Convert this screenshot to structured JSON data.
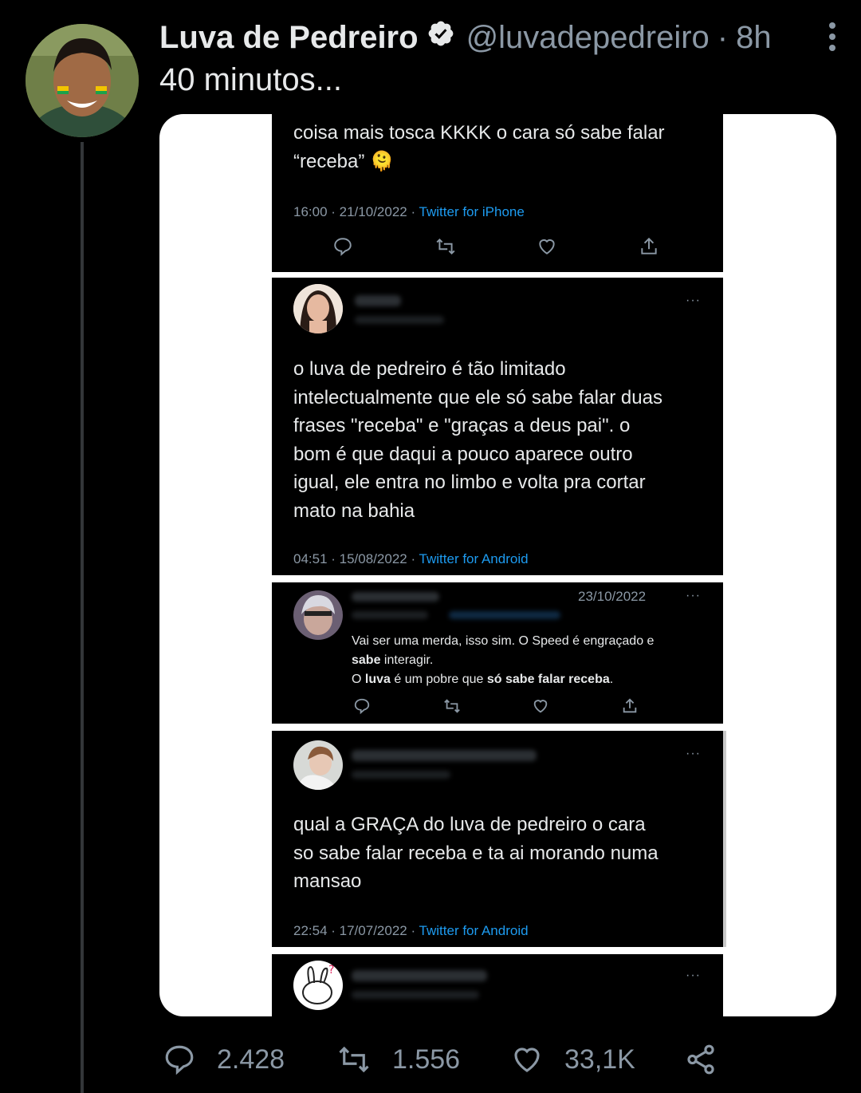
{
  "tweet": {
    "author_name": "Luva de Pedreiro",
    "handle": "@luvadepedreiro",
    "separator": "·",
    "time": "8h",
    "text": "40 minutos...",
    "verified_icon": "verified-badge-icon",
    "more_icon": "vertical-dots-icon"
  },
  "media": {
    "shot1": {
      "text": "coisa mais tosca KKKK o cara só sabe falar\n“receba” 🫠",
      "time": "16:00 · 21/10/2022 · ",
      "source": "Twitter for iPhone"
    },
    "shot2": {
      "text": "o luva de pedreiro é tão limitado\nintelectualmente que ele só sabe falar duas\nfrases \"receba\" e \"graças a deus pai\". o\nbom é que daqui a pouco aparece outro\nigual, ele entra no limbo e volta pra cortar\nmato na bahia",
      "time": "04:51 · 15/08/2022 · ",
      "source": "Twitter for Android",
      "more": "···"
    },
    "shot3": {
      "date": "23/10/2022",
      "line1": "Vai ser uma merda, isso sim. O Speed é engraçado e",
      "line2_bold": "sabe",
      "line2_rest": " interagir.",
      "line3_start": "O ",
      "line3_bold1": "luva",
      "line3_mid": " é um pobre que ",
      "line3_bold2": "só sabe falar receba",
      "line3_end": ".",
      "more": "···"
    },
    "shot4": {
      "text": "qual a GRAÇA do luva de pedreiro o cara\nso sabe falar receba e ta ai morando numa\nmansao",
      "time": "22:54 · 17/07/2022 · ",
      "source": "Twitter for Android",
      "more": "···"
    },
    "shot5": {
      "more": "···"
    }
  },
  "actions": {
    "replies": "2.428",
    "retweets": "1.556",
    "likes": "33,1K"
  },
  "colors": {
    "background": "#000000",
    "link": "#1d9bf0",
    "muted": "#8b98a5"
  }
}
